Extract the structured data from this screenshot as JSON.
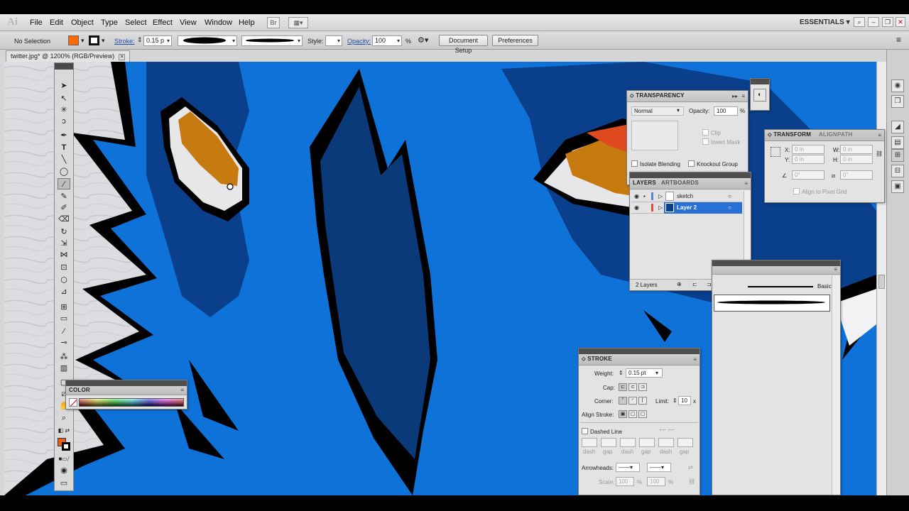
{
  "app": {
    "logo": "Ai",
    "menu": [
      "File",
      "Edit",
      "Object",
      "Type",
      "Select",
      "Effect",
      "View",
      "Window",
      "Help"
    ],
    "bridge_button": "Br",
    "workspace": "ESSENTIALS"
  },
  "control_bar": {
    "selection": "No Selection",
    "fill_color": "#ff6a00",
    "stroke_label": "Stroke:",
    "stroke_weight": "0.15 p",
    "style_label": "Style:",
    "opacity_label": "Opacity:",
    "opacity_value": "100",
    "opacity_unit": "%",
    "document_setup": "Document Setup",
    "preferences": "Preferences"
  },
  "document": {
    "tab_title": "twitter.jpg* @ 1200% (RGB/Preview)"
  },
  "panels": {
    "transparency": {
      "title": "TRANSPARENCY",
      "blend_mode": "Normal",
      "opacity_label": "Opacity:",
      "opacity_value": "100",
      "opacity_unit": "%",
      "clip": "Clip",
      "invert_mask": "Invert Mask",
      "isolate_blending": "Isolate Blending",
      "knockout_group": "Knockout Group"
    },
    "transform": {
      "tabs": [
        "TRANSFORM",
        "ALIGN",
        "PATH"
      ],
      "x_label": "X:",
      "x_value": "0 in",
      "y_label": "Y:",
      "y_value": "0 in",
      "w_label": "W:",
      "w_value": "0 in",
      "h_label": "H:",
      "h_value": "0 in",
      "angle_value": "0°",
      "shear_value": "0°",
      "align_pixel_grid": "Align to Pixel Grid"
    },
    "layers": {
      "tabs": [
        "LAYERS",
        "ARTBOARDS"
      ],
      "items": [
        {
          "name": "sketch",
          "color": "#5a7fd6",
          "selected": false
        },
        {
          "name": "Layer 2",
          "color": "#e74b3c",
          "selected": true
        }
      ],
      "count_label": "2 Layers"
    },
    "brushes": {
      "basic_label": "Basic"
    },
    "stroke": {
      "title": "STROKE",
      "weight_label": "Weight:",
      "weight_value": "0.15 pt",
      "cap_label": "Cap:",
      "corner_label": "Corner:",
      "limit_label": "Limit:",
      "limit_value": "10",
      "limit_unit": "x",
      "align_stroke_label": "Align Stroke:",
      "dashed_line": "Dashed Line",
      "dash_labels": [
        "dash",
        "gap",
        "dash",
        "gap",
        "dash",
        "gap"
      ],
      "arrowheads_label": "Arrowheads:",
      "scale_label": "Scale:",
      "scale_start": "100",
      "scale_end": "100",
      "scale_unit": "%"
    },
    "color": {
      "title": "COLOR"
    }
  },
  "colors": {
    "canvas_blue": "#0f72d9",
    "dark_blue": "#0a3a7a",
    "eye_orange": "#c77a10",
    "fill_swatch": "#e8601c"
  }
}
